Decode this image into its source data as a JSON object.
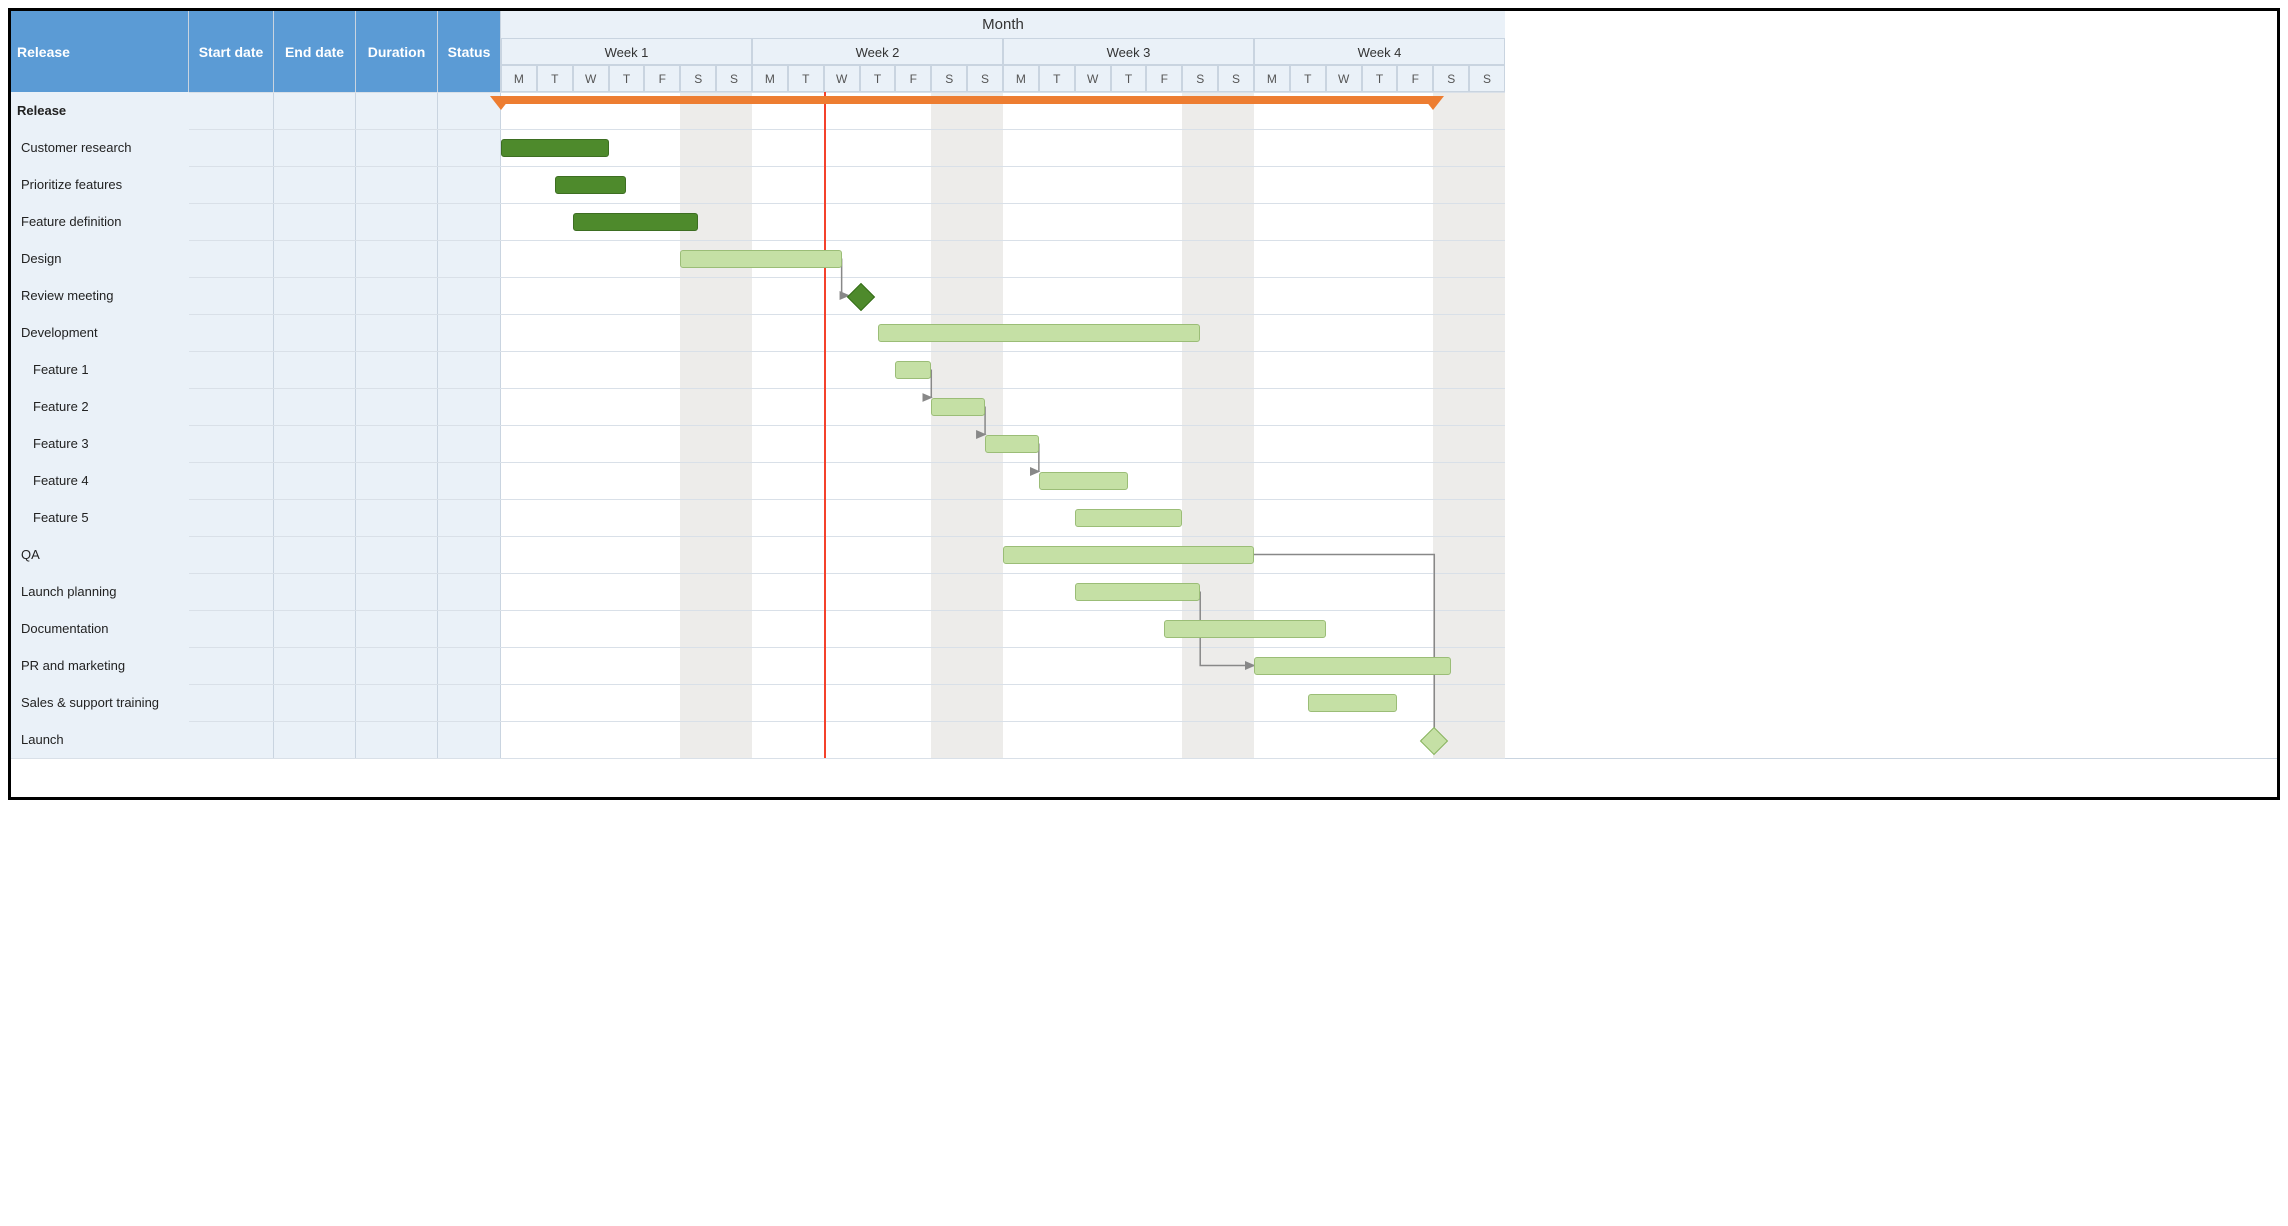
{
  "columns": {
    "release": "Release",
    "start": "Start date",
    "end": "End date",
    "duration": "Duration",
    "status": "Status"
  },
  "timeline": {
    "title": "Month",
    "weeks": [
      "Week 1",
      "Week 2",
      "Week 3",
      "Week 4"
    ],
    "days": [
      "M",
      "T",
      "W",
      "T",
      "F",
      "S",
      "S"
    ]
  },
  "tasks": [
    {
      "name": "Release",
      "indent": 0,
      "bold": true,
      "type": "summary",
      "start": 0,
      "end": 26
    },
    {
      "name": "Customer research",
      "indent": 1,
      "type": "dark",
      "start": 0,
      "end": 3
    },
    {
      "name": "Prioritize features",
      "indent": 1,
      "type": "dark",
      "start": 1.5,
      "end": 3.5
    },
    {
      "name": "Feature definition",
      "indent": 1,
      "type": "dark",
      "start": 2,
      "end": 5.5
    },
    {
      "name": "Design",
      "indent": 1,
      "type": "light",
      "start": 5,
      "end": 9.5
    },
    {
      "name": "Review meeting",
      "indent": 1,
      "type": "milestone-dark",
      "at": 10
    },
    {
      "name": "Development",
      "indent": 1,
      "type": "light",
      "start": 10.5,
      "end": 19.5
    },
    {
      "name": "Feature 1",
      "indent": 2,
      "type": "light",
      "start": 11,
      "end": 12
    },
    {
      "name": "Feature 2",
      "indent": 2,
      "type": "light",
      "start": 12,
      "end": 13.5
    },
    {
      "name": "Feature 3",
      "indent": 2,
      "type": "light",
      "start": 13.5,
      "end": 15
    },
    {
      "name": "Feature 4",
      "indent": 2,
      "type": "light",
      "start": 15,
      "end": 17.5
    },
    {
      "name": "Feature 5",
      "indent": 2,
      "type": "light",
      "start": 16,
      "end": 19
    },
    {
      "name": "QA",
      "indent": 1,
      "type": "light",
      "start": 14,
      "end": 21
    },
    {
      "name": "Launch planning",
      "indent": 1,
      "type": "light",
      "start": 16,
      "end": 19.5
    },
    {
      "name": "Documentation",
      "indent": 1,
      "type": "light",
      "start": 18.5,
      "end": 23
    },
    {
      "name": "PR and  marketing",
      "indent": 1,
      "type": "light",
      "start": 21,
      "end": 26.5
    },
    {
      "name": "Sales & support training",
      "indent": 1,
      "type": "light",
      "start": 22.5,
      "end": 25
    },
    {
      "name": "Launch",
      "indent": 1,
      "type": "milestone-light",
      "at": 26
    }
  ],
  "today_day": 9,
  "colors": {
    "header_blue": "#5b9bd5",
    "pale_blue": "#eaf1f8",
    "orange": "#ed7d31",
    "dark_green": "#4e8a2c",
    "light_green": "#c5e0a5",
    "today": "#f4412b"
  },
  "chart_data": {
    "type": "gantt",
    "title": "Month",
    "x_unit": "day (0 = Week 1 Monday)",
    "xlim": [
      0,
      28
    ],
    "tasks": [
      {
        "name": "Release",
        "type": "summary",
        "start": 0,
        "end": 26
      },
      {
        "name": "Customer research",
        "start": 0,
        "end": 3,
        "complete": true
      },
      {
        "name": "Prioritize features",
        "start": 1.5,
        "end": 3.5,
        "complete": true
      },
      {
        "name": "Feature definition",
        "start": 2,
        "end": 5.5,
        "complete": true
      },
      {
        "name": "Design",
        "start": 5,
        "end": 9.5,
        "complete": false,
        "depends_to": "Review meeting"
      },
      {
        "name": "Review meeting",
        "type": "milestone",
        "at": 10
      },
      {
        "name": "Development",
        "start": 10.5,
        "end": 19.5
      },
      {
        "name": "Feature 1",
        "start": 11,
        "end": 12,
        "parent": "Development",
        "depends_to": "Feature 2"
      },
      {
        "name": "Feature 2",
        "start": 12,
        "end": 13.5,
        "parent": "Development",
        "depends_to": "Feature 3"
      },
      {
        "name": "Feature 3",
        "start": 13.5,
        "end": 15,
        "parent": "Development",
        "depends_to": "Feature 4"
      },
      {
        "name": "Feature 4",
        "start": 15,
        "end": 17.5,
        "parent": "Development"
      },
      {
        "name": "Feature 5",
        "start": 16,
        "end": 19,
        "parent": "Development"
      },
      {
        "name": "QA",
        "start": 14,
        "end": 21,
        "depends_to": "Launch"
      },
      {
        "name": "Launch planning",
        "start": 16,
        "end": 19.5,
        "depends_to": "PR and  marketing"
      },
      {
        "name": "Documentation",
        "start": 18.5,
        "end": 23
      },
      {
        "name": "PR and  marketing",
        "start": 21,
        "end": 26.5
      },
      {
        "name": "Sales & support training",
        "start": 22.5,
        "end": 25
      },
      {
        "name": "Launch",
        "type": "milestone",
        "at": 26
      }
    ],
    "today": 9
  }
}
